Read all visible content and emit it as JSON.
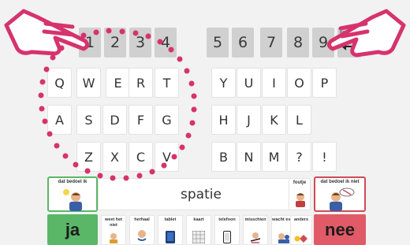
{
  "number_keys": [
    "1",
    "2",
    "3",
    "4",
    "5",
    "6",
    "7",
    "8",
    "9"
  ],
  "backspace_label": "backspace",
  "row_qwerty": [
    "Q",
    "W",
    "E",
    "R",
    "T",
    "Y",
    "U",
    "I",
    "O",
    "P"
  ],
  "row_asdf": [
    "A",
    "S",
    "D",
    "F",
    "G",
    "H",
    "J",
    "K",
    "L"
  ],
  "row_zxcv": [
    "Z",
    "X",
    "C",
    "V",
    "B",
    "N",
    "M",
    "?",
    "!"
  ],
  "space_label": "spatie",
  "card_left_label": "dat bedoel ik",
  "card_foutje_label": "foutje",
  "card_right_label": "dat bedoel ik niet",
  "yes_label": "ja",
  "no_label": "nee",
  "quick_items": [
    "weet het niet",
    "herhaal",
    "tablet",
    "kaart",
    "telefoon",
    "misschien",
    "wacht even",
    "anders"
  ],
  "colors": {
    "yes_bg": "#5ab768",
    "no_bg": "#e05a67",
    "green_border": "#5ab768",
    "red_border": "#d04a57",
    "hand": "#d6336c",
    "dots": "#d6336c"
  }
}
